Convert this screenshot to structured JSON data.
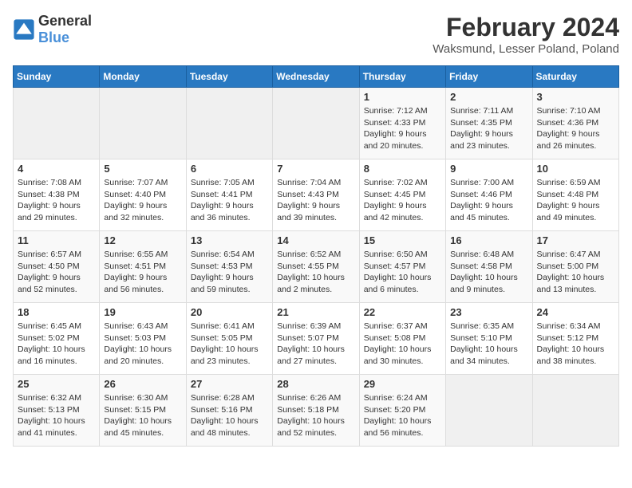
{
  "logo": {
    "text_general": "General",
    "text_blue": "Blue"
  },
  "header": {
    "title": "February 2024",
    "subtitle": "Waksmund, Lesser Poland, Poland"
  },
  "days_of_week": [
    "Sunday",
    "Monday",
    "Tuesday",
    "Wednesday",
    "Thursday",
    "Friday",
    "Saturday"
  ],
  "weeks": [
    [
      {
        "day": "",
        "info": ""
      },
      {
        "day": "",
        "info": ""
      },
      {
        "day": "",
        "info": ""
      },
      {
        "day": "",
        "info": ""
      },
      {
        "day": "1",
        "info": "Sunrise: 7:12 AM\nSunset: 4:33 PM\nDaylight: 9 hours\nand 20 minutes."
      },
      {
        "day": "2",
        "info": "Sunrise: 7:11 AM\nSunset: 4:35 PM\nDaylight: 9 hours\nand 23 minutes."
      },
      {
        "day": "3",
        "info": "Sunrise: 7:10 AM\nSunset: 4:36 PM\nDaylight: 9 hours\nand 26 minutes."
      }
    ],
    [
      {
        "day": "4",
        "info": "Sunrise: 7:08 AM\nSunset: 4:38 PM\nDaylight: 9 hours\nand 29 minutes."
      },
      {
        "day": "5",
        "info": "Sunrise: 7:07 AM\nSunset: 4:40 PM\nDaylight: 9 hours\nand 32 minutes."
      },
      {
        "day": "6",
        "info": "Sunrise: 7:05 AM\nSunset: 4:41 PM\nDaylight: 9 hours\nand 36 minutes."
      },
      {
        "day": "7",
        "info": "Sunrise: 7:04 AM\nSunset: 4:43 PM\nDaylight: 9 hours\nand 39 minutes."
      },
      {
        "day": "8",
        "info": "Sunrise: 7:02 AM\nSunset: 4:45 PM\nDaylight: 9 hours\nand 42 minutes."
      },
      {
        "day": "9",
        "info": "Sunrise: 7:00 AM\nSunset: 4:46 PM\nDaylight: 9 hours\nand 45 minutes."
      },
      {
        "day": "10",
        "info": "Sunrise: 6:59 AM\nSunset: 4:48 PM\nDaylight: 9 hours\nand 49 minutes."
      }
    ],
    [
      {
        "day": "11",
        "info": "Sunrise: 6:57 AM\nSunset: 4:50 PM\nDaylight: 9 hours\nand 52 minutes."
      },
      {
        "day": "12",
        "info": "Sunrise: 6:55 AM\nSunset: 4:51 PM\nDaylight: 9 hours\nand 56 minutes."
      },
      {
        "day": "13",
        "info": "Sunrise: 6:54 AM\nSunset: 4:53 PM\nDaylight: 9 hours\nand 59 minutes."
      },
      {
        "day": "14",
        "info": "Sunrise: 6:52 AM\nSunset: 4:55 PM\nDaylight: 10 hours\nand 2 minutes."
      },
      {
        "day": "15",
        "info": "Sunrise: 6:50 AM\nSunset: 4:57 PM\nDaylight: 10 hours\nand 6 minutes."
      },
      {
        "day": "16",
        "info": "Sunrise: 6:48 AM\nSunset: 4:58 PM\nDaylight: 10 hours\nand 9 minutes."
      },
      {
        "day": "17",
        "info": "Sunrise: 6:47 AM\nSunset: 5:00 PM\nDaylight: 10 hours\nand 13 minutes."
      }
    ],
    [
      {
        "day": "18",
        "info": "Sunrise: 6:45 AM\nSunset: 5:02 PM\nDaylight: 10 hours\nand 16 minutes."
      },
      {
        "day": "19",
        "info": "Sunrise: 6:43 AM\nSunset: 5:03 PM\nDaylight: 10 hours\nand 20 minutes."
      },
      {
        "day": "20",
        "info": "Sunrise: 6:41 AM\nSunset: 5:05 PM\nDaylight: 10 hours\nand 23 minutes."
      },
      {
        "day": "21",
        "info": "Sunrise: 6:39 AM\nSunset: 5:07 PM\nDaylight: 10 hours\nand 27 minutes."
      },
      {
        "day": "22",
        "info": "Sunrise: 6:37 AM\nSunset: 5:08 PM\nDaylight: 10 hours\nand 30 minutes."
      },
      {
        "day": "23",
        "info": "Sunrise: 6:35 AM\nSunset: 5:10 PM\nDaylight: 10 hours\nand 34 minutes."
      },
      {
        "day": "24",
        "info": "Sunrise: 6:34 AM\nSunset: 5:12 PM\nDaylight: 10 hours\nand 38 minutes."
      }
    ],
    [
      {
        "day": "25",
        "info": "Sunrise: 6:32 AM\nSunset: 5:13 PM\nDaylight: 10 hours\nand 41 minutes."
      },
      {
        "day": "26",
        "info": "Sunrise: 6:30 AM\nSunset: 5:15 PM\nDaylight: 10 hours\nand 45 minutes."
      },
      {
        "day": "27",
        "info": "Sunrise: 6:28 AM\nSunset: 5:16 PM\nDaylight: 10 hours\nand 48 minutes."
      },
      {
        "day": "28",
        "info": "Sunrise: 6:26 AM\nSunset: 5:18 PM\nDaylight: 10 hours\nand 52 minutes."
      },
      {
        "day": "29",
        "info": "Sunrise: 6:24 AM\nSunset: 5:20 PM\nDaylight: 10 hours\nand 56 minutes."
      },
      {
        "day": "",
        "info": ""
      },
      {
        "day": "",
        "info": ""
      }
    ]
  ]
}
